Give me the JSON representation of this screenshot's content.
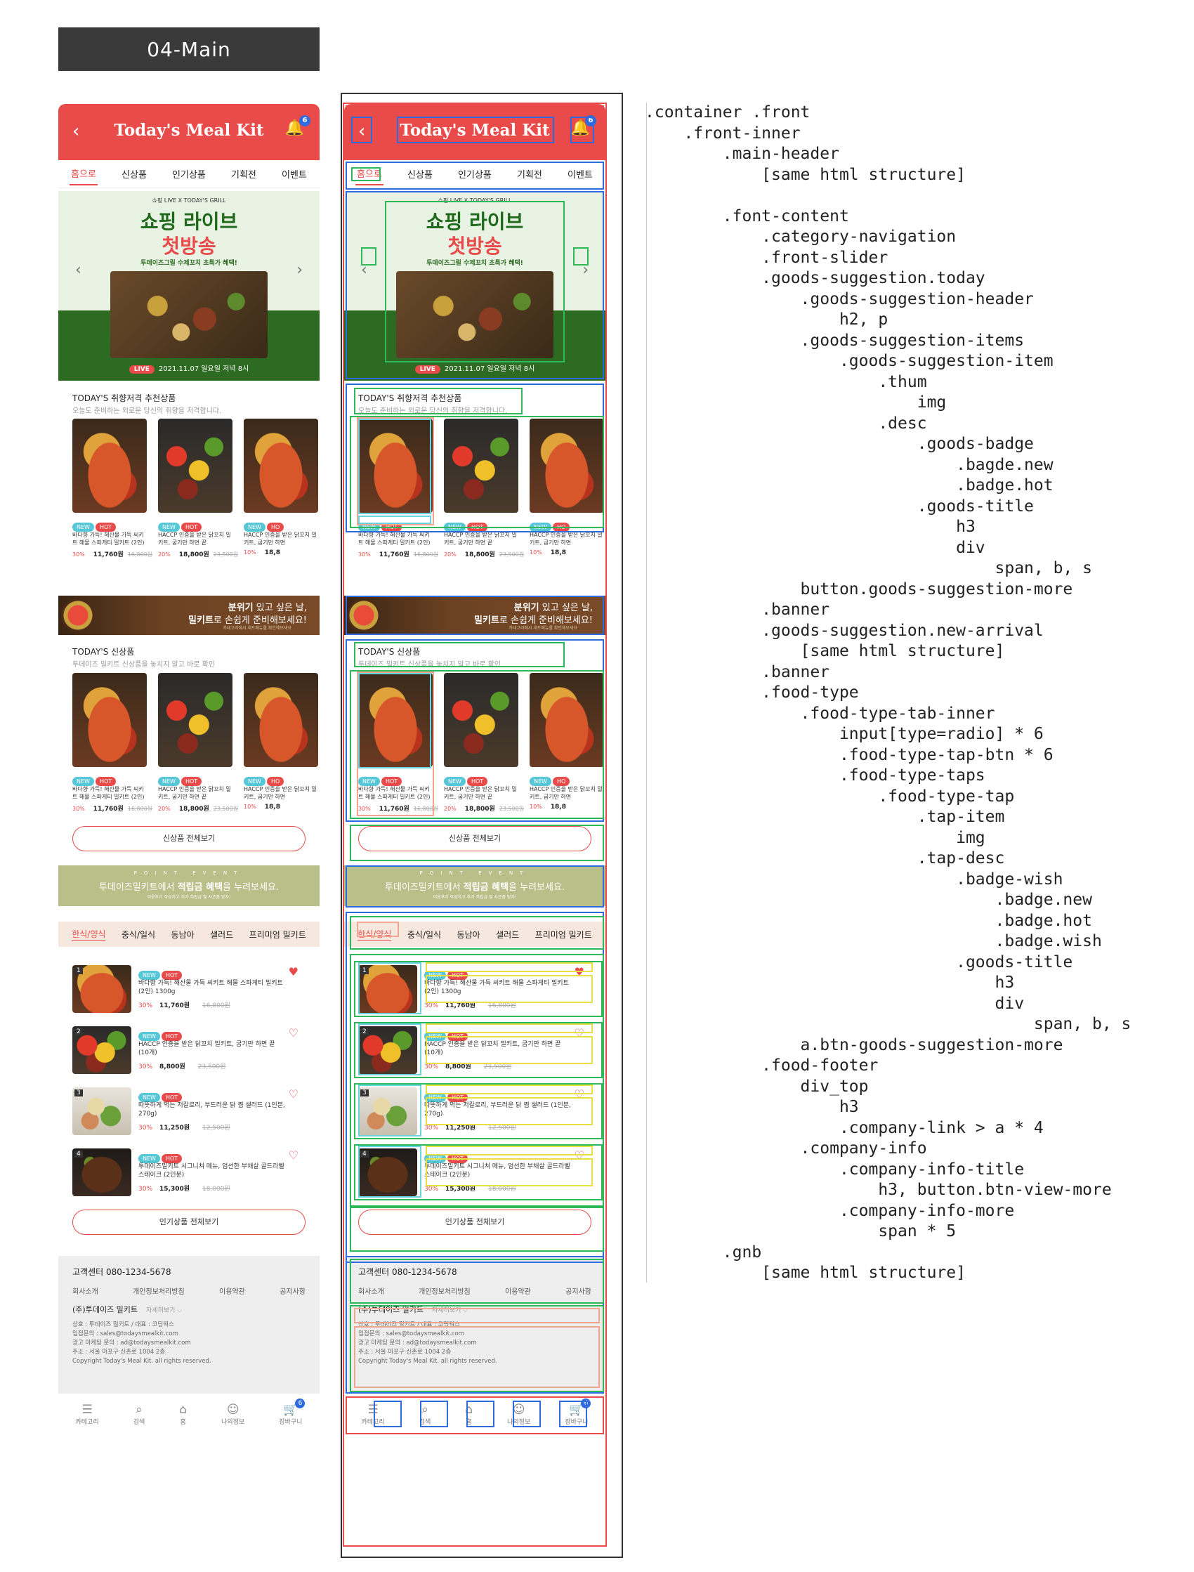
{
  "page_title": "04-Main",
  "app": {
    "title": "Today's Meal Kit",
    "back_icon": "‹",
    "bell_count": "6"
  },
  "category_nav": [
    "홈으로",
    "신상품",
    "인기상품",
    "기획전",
    "이벤트"
  ],
  "slider": {
    "tag": "쇼핑 LIVE X TODAY'S GRILL",
    "headline1": "쇼핑 라이브",
    "headline2": "첫방송",
    "sub": "투데이즈그릴 수제꼬치 초특가 혜택!",
    "live_badge": "LIVE",
    "live_date": "2021.11.07 일요일 저녁 8시"
  },
  "today": {
    "title": "TODAY'S 취향저격 추천상품",
    "desc": "오늘도 준비하는 외로운 당신의 취향을 저격합니다."
  },
  "new_arrival": {
    "title": "TODAY'S 신상품",
    "desc": "투데이즈 밀키트 신상품을 놓치지 말고 바로 확인",
    "more": "신상품 전체보기"
  },
  "goods": [
    {
      "title": "바다향 가득! 해산물 가득 씨키트 해물 스파게티 밀키트 (2인)",
      "discount": "30%",
      "price": "11,760원",
      "original": "16,800원",
      "badges": [
        "NEW",
        "HOT"
      ]
    },
    {
      "title": "HACCP 인증을 받은 닭꼬치 밀키트, 굽기만 하면 끝",
      "discount": "20%",
      "price": "18,800원",
      "original": "23,500원",
      "badges": [
        "NEW",
        "HOT"
      ]
    },
    {
      "title": "HACCP 인증을 받은 닭꼬치 밀키트, 굽기만 하면",
      "discount": "10%",
      "price": "18,8",
      "original": "",
      "badges": [
        "NEW",
        "HO"
      ]
    }
  ],
  "banner": {
    "line1a": "분위기",
    "line1b": " 있고 싶은 날,",
    "line2a": "밀키트",
    "line2b": "로 손쉽게 준비해보세요!",
    "line3": "카테고리에서 세트메뉴를 확인해보세요"
  },
  "point": {
    "eyebrow": "POINT EVENT",
    "line_a": "투데이즈밀키트에서 ",
    "line_b": "적립금 혜택",
    "line_c": "을 누려보세요.",
    "sub": "이용후기 작성하고 추가 적립금 및 사은품 받자!"
  },
  "food_tabs": [
    "한식/양식",
    "중식/일식",
    "동남아",
    "샐러드",
    "프리미엄 밀키트"
  ],
  "food_items": [
    {
      "rank": "1",
      "title": "바다향 가득! 해산물 가득 씨키트 해물 스파게티 밀키트 (2인) 1300g",
      "discount": "30%",
      "price": "11,760원",
      "original": "16,800원",
      "heart": "♥"
    },
    {
      "rank": "2",
      "title": "HACCP 인증을 받은 닭꼬치 밀키트, 굽기만 하면 끝 (10개)",
      "discount": "30%",
      "price": "8,800원",
      "original": "23,500원",
      "heart": "♡"
    },
    {
      "rank": "3",
      "title": "따뜻하게 먹는 저칼로리, 부드러운 닭 찜 샐러드 (1인분, 270g)",
      "discount": "30%",
      "price": "11,250원",
      "original": "12,500원",
      "heart": "♡"
    },
    {
      "rank": "4",
      "title": "투데이즈밀키트 시그니쳐 메뉴, 엄선한 부채살 골드라벨 스테이크 (2인분)",
      "discount": "30%",
      "price": "15,300원",
      "original": "18,000원",
      "heart": "♡"
    }
  ],
  "popular_more": "인기상품 전체보기",
  "footer": {
    "cs": "고객센터  080-1234-5678",
    "links": [
      "회사소개",
      "개인정보처리방침",
      "이용약관",
      "공지사항"
    ],
    "company": "(주)투데이즈 밀키트",
    "view_more": "자세히보기 ⌵",
    "info": [
      "상호 : 투데이즈 밀키트 / 대표 : 코딩웍스",
      "입점문의 : sales@todaysmealkit.com",
      "광고 마케팅 문의 : ad@todaysmealkit.com",
      "주소 : 서울 마포구 신촌로 1004 2층",
      "Copyright Today's Meal Kit. all rights reserved."
    ]
  },
  "gnb": [
    {
      "icon": "☰",
      "label": "카테고리"
    },
    {
      "icon": "⌕",
      "label": "검색"
    },
    {
      "icon": "⌂",
      "label": "홈"
    },
    {
      "icon": "☺",
      "label": "나의정보"
    },
    {
      "icon": "🛒",
      "label": "장바구니",
      "count": "6"
    }
  ],
  "tree": [
    ".container .front",
    "    .front-inner",
    "        .main-header",
    "            [same html structure]",
    "",
    "        .font-content",
    "            .category-navigation",
    "            .front-slider",
    "            .goods-suggestion.today",
    "                .goods-suggestion-header",
    "                    h2, p",
    "                .goods-suggestion-items",
    "                    .goods-suggestion-item",
    "                        .thum",
    "                            img",
    "                        .desc",
    "                            .goods-badge",
    "                                .bagde.new",
    "                                .badge.hot",
    "                            .goods-title",
    "                                h3",
    "                                div",
    "                                    span, b, s",
    "                button.goods-suggestion-more",
    "            .banner",
    "            .goods-suggestion.new-arrival",
    "                [same html structure]",
    "            .banner",
    "            .food-type",
    "                .food-type-tab-inner",
    "                    input[type=radio] * 6",
    "                    .food-type-tap-btn * 6",
    "                    .food-type-taps",
    "                        .food-type-tap",
    "                            .tap-item",
    "                                img",
    "                            .tap-desc",
    "                                .badge-wish",
    "                                    .badge.new",
    "                                    .badge.hot",
    "                                    .badge.wish",
    "                                .goods-title",
    "                                    h3",
    "                                    div",
    "                                        span, b, s",
    "                a.btn-goods-suggestion-more",
    "            .food-footer",
    "                div_top",
    "                    h3",
    "                    .company-link > a * 4",
    "                .company-info",
    "                    .company-info-title",
    "                        h3, button.btn-view-more",
    "                    .company-info-more",
    "                        span * 5",
    "        .gnb",
    "            [same html structure]"
  ]
}
